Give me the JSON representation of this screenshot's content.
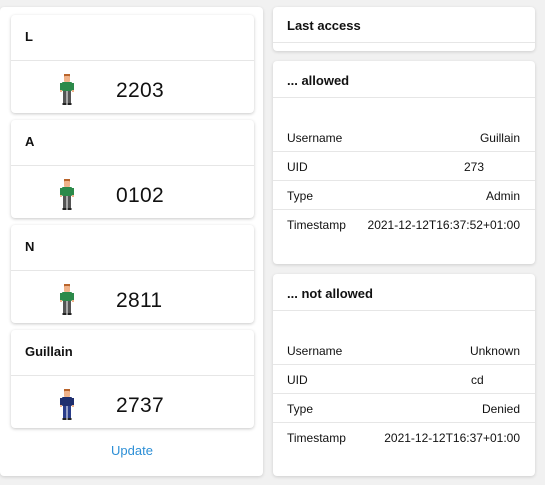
{
  "users": [
    {
      "name": "L",
      "code": "2203",
      "icon": "person-green-icon",
      "shirt": "#2c8a4a",
      "pants": "#555555"
    },
    {
      "name": "A",
      "code": "0102",
      "icon": "person-green-icon",
      "shirt": "#2c8a4a",
      "pants": "#555555"
    },
    {
      "name": "N",
      "code": "2811",
      "icon": "person-green-icon",
      "shirt": "#2c8a4a",
      "pants": "#555555"
    },
    {
      "name": "Guillain",
      "code": "2737",
      "icon": "person-blue-icon",
      "shirt": "#1f2f6e",
      "pants": "#2a3d8a"
    }
  ],
  "update_label": "Update",
  "last_access": {
    "title": "Last access"
  },
  "allowed": {
    "title": "... allowed",
    "rows": [
      {
        "key": "Username",
        "value": "Guillain"
      },
      {
        "key": "UID",
        "value": "273"
      },
      {
        "key": "Type",
        "value": "Admin"
      },
      {
        "key": "Timestamp",
        "value": "2021-12-12T16:37:52+01:00"
      }
    ]
  },
  "not_allowed": {
    "title": "... not allowed",
    "rows": [
      {
        "key": "Username",
        "value": "Unknown"
      },
      {
        "key": "UID",
        "value": "cd"
      },
      {
        "key": "Type",
        "value": "Denied"
      },
      {
        "key": "Timestamp",
        "value": "2021-12-12T16:37+01:00"
      }
    ]
  },
  "colors": {
    "link": "#2d8fd6",
    "skin": "#f0b38a",
    "hair": "#b9642b"
  }
}
